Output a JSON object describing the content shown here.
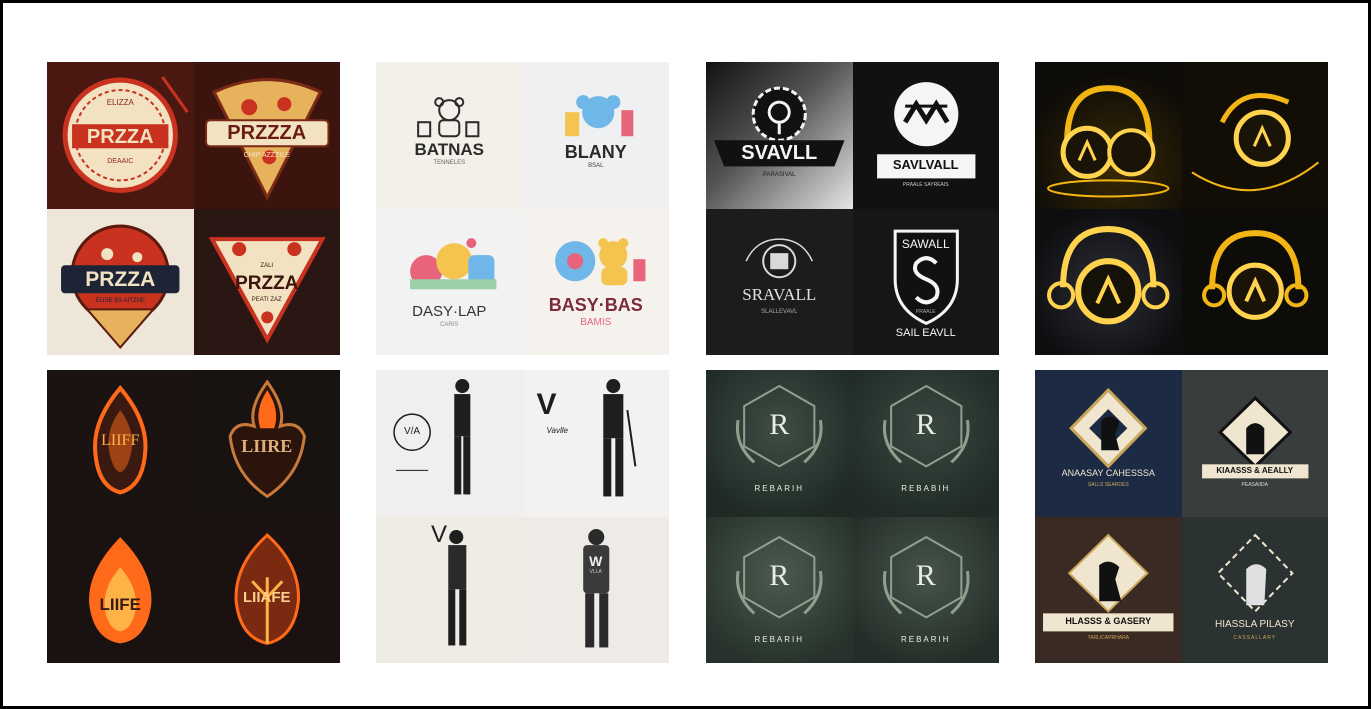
{
  "cards": [
    {
      "theme": "pizza",
      "tiles": [
        {
          "title": "PRZZA",
          "sub": "ELIZZA",
          "sub2": "DEAAIC"
        },
        {
          "title": "PRZZZA",
          "sub": "CHIP AZZZILE"
        },
        {
          "title": "PRZZA",
          "sub": "ELISE BS AITZNE"
        },
        {
          "title": "PRZZA",
          "sub": "PEATI ZAZ",
          "sub2": "ZALI"
        }
      ],
      "colors": {
        "bg1": "#5a1d12",
        "bg2": "#3a140d",
        "bg3": "#eee6d8",
        "bg4": "#2a1612",
        "accent": "#c8321f",
        "cream": "#f2e2c2"
      }
    },
    {
      "theme": "toys",
      "tiles": [
        {
          "title": "BATNAS",
          "sub": "TENNELES"
        },
        {
          "title": "BLANY",
          "sub": "BSAL"
        },
        {
          "title": "DASY·LAP",
          "sub": "CARIS"
        },
        {
          "title": "BASY·BAS",
          "sub": "BAMIS"
        }
      ],
      "colors": {
        "bg": "#f3f1ee",
        "dark": "#2b2b2b",
        "pink": "#e8647a",
        "blue": "#6fb7e8",
        "yellow": "#f4c44f",
        "maroon": "#7b2a3a"
      }
    },
    {
      "theme": "savall",
      "tiles": [
        {
          "title": "SVAVLL",
          "sub": "PARASIVAL"
        },
        {
          "title": "SAVLVALL",
          "sub": "PRAALE SAYREAIS"
        },
        {
          "title": "SRAVALL",
          "sub": "SLALLEVAVL"
        },
        {
          "title": "SAIL EAVLL",
          "sub": "SAWALL",
          "sub2": "PRAALE"
        }
      ],
      "colors": {
        "bg": "#1a1a1a",
        "light": "#d9d9d9",
        "white": "#f5f5f5"
      }
    },
    {
      "theme": "headphones",
      "tiles": [
        {},
        {},
        {},
        {}
      ],
      "colors": {
        "bg": "#0e0c08",
        "glow": "#f3b513",
        "gold": "#ffd34d"
      }
    },
    {
      "theme": "fire",
      "tiles": [
        {
          "title": "LIIFF"
        },
        {
          "title": "LIIRE"
        },
        {
          "title": "LIIFE"
        },
        {
          "title": "LIIAFE"
        }
      ],
      "colors": {
        "bg": "#1a1210",
        "flame": "#ff6a1a",
        "ember": "#ffb347",
        "dark": "#3a1a10"
      }
    },
    {
      "theme": "worker",
      "tiles": [
        {
          "title": "V/A"
        },
        {
          "title": "V",
          "sub": "Vavlle"
        },
        {
          "title": "V"
        },
        {
          "title": "W",
          "sub": "VLLA"
        }
      ],
      "colors": {
        "bg": "#eeece8",
        "dark": "#1e1e1e"
      }
    },
    {
      "theme": "rebarih",
      "tiles": [
        {
          "title": "R",
          "sub": "REBARIH"
        },
        {
          "title": "R",
          "sub": "REBABIH"
        },
        {
          "title": "R",
          "sub": "REBARIH"
        },
        {
          "title": "R",
          "sub": "REBARIH"
        }
      ],
      "colors": {
        "bg": "#26332c",
        "bg2": "#3d4a42",
        "leaf": "#8da08e",
        "white": "#e9ece6"
      }
    },
    {
      "theme": "chess",
      "tiles": [
        {
          "title": "ANAASAY CAHESSSA",
          "sub": "SALLS SEARDES"
        },
        {
          "title": "KIAASSS & AEALLY",
          "sub": "PEASAIIDA"
        },
        {
          "title": "HLASSS & GASERY",
          "sub": "TARLICAPRHARA"
        },
        {
          "title": "HIASSLA PILASY",
          "sub": "CASSALLARY"
        }
      ],
      "colors": {
        "bg1": "#1d2a44",
        "bg2": "#3a3d3e",
        "bg3": "#3a2a24",
        "bg4": "#2a3331",
        "gold": "#c9a55a",
        "cream": "#f0e6cf"
      }
    }
  ]
}
